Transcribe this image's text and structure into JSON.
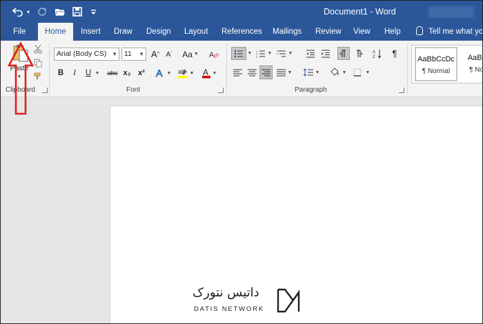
{
  "title_bar": {
    "document_title": "Document1  -  Word",
    "qat": [
      {
        "name": "undo-icon"
      },
      {
        "name": "redo-icon"
      },
      {
        "name": "open-folder-icon"
      },
      {
        "name": "save-icon"
      },
      {
        "name": "customize-qat-icon"
      }
    ]
  },
  "tabs": [
    "File",
    "Home",
    "Insert",
    "Draw",
    "Design",
    "Layout",
    "References",
    "Mailings",
    "Review",
    "View",
    "Help"
  ],
  "active_tab": "Home",
  "tell_me": "Tell me what yo",
  "clipboard": {
    "paste_label": "Paste",
    "group_label": "Clipboard"
  },
  "font": {
    "font_name": "Arial (Body CS)",
    "font_size": "11",
    "change_case": "Aa",
    "group_label": "Font",
    "bold": "B",
    "italic": "I",
    "underline": "U",
    "strikethrough": "abc",
    "subscript": "x₂",
    "superscript": "x²"
  },
  "paragraph": {
    "group_label": "Paragraph"
  },
  "styles": {
    "items": [
      {
        "sample": "AaBbCcDc",
        "name": "¶ Normal"
      },
      {
        "sample": "AaBbCc",
        "name": "¶ No Sp"
      }
    ]
  },
  "watermark": {
    "persian": "داتیس نتورک",
    "english": "DATIS NETWORK"
  },
  "colors": {
    "ribbon_blue": "#2b579a",
    "ribbon_bg": "#f3f3f3",
    "annotation_arrow": "#e0201c",
    "highlight_yellow": "#ffff00",
    "font_color_red": "#d00000"
  }
}
